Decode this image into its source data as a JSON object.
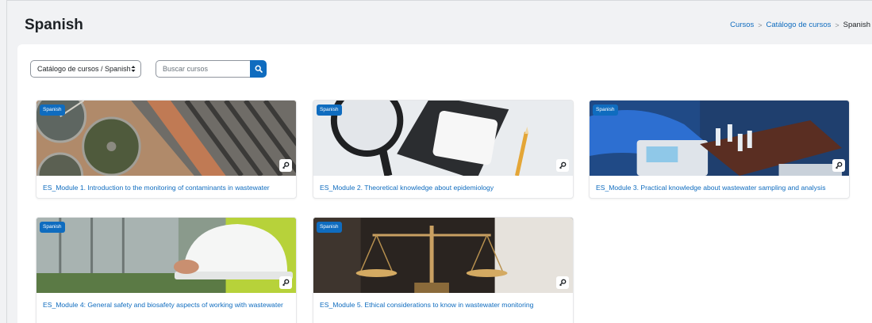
{
  "page": {
    "title": "Spanish"
  },
  "breadcrumb": {
    "items": [
      "Cursos",
      "Catálogo de cursos"
    ],
    "separator": ">",
    "current": "Spanish"
  },
  "filters": {
    "category_select": "Catálogo de cursos / Spanish",
    "search_placeholder": "Buscar cursos"
  },
  "icons": {
    "search": "search-icon",
    "enrol": "self-enrol-key-icon",
    "select_caret": "sort-caret-icon"
  },
  "colors": {
    "accent": "#0f6cbf",
    "background": "#f1f2f4",
    "card": "#ffffff"
  },
  "courses": [
    {
      "badge": "Spanish",
      "title": "ES_Module 1. Introduction to the monitoring of contaminants in wastewater"
    },
    {
      "badge": "Spanish",
      "title": "ES_Module 2. Theoretical knowledge about epidemiology"
    },
    {
      "badge": "Spanish",
      "title": "ES_Module 3. Practical knowledge about wastewater sampling and analysis"
    },
    {
      "badge": "Spanish",
      "title": "ES_Module 4: General safety and biosafety aspects of working with wastewater"
    },
    {
      "badge": "Spanish",
      "title": "ES_Module 5. Ethical considerations to know in wastewater monitoring"
    }
  ]
}
